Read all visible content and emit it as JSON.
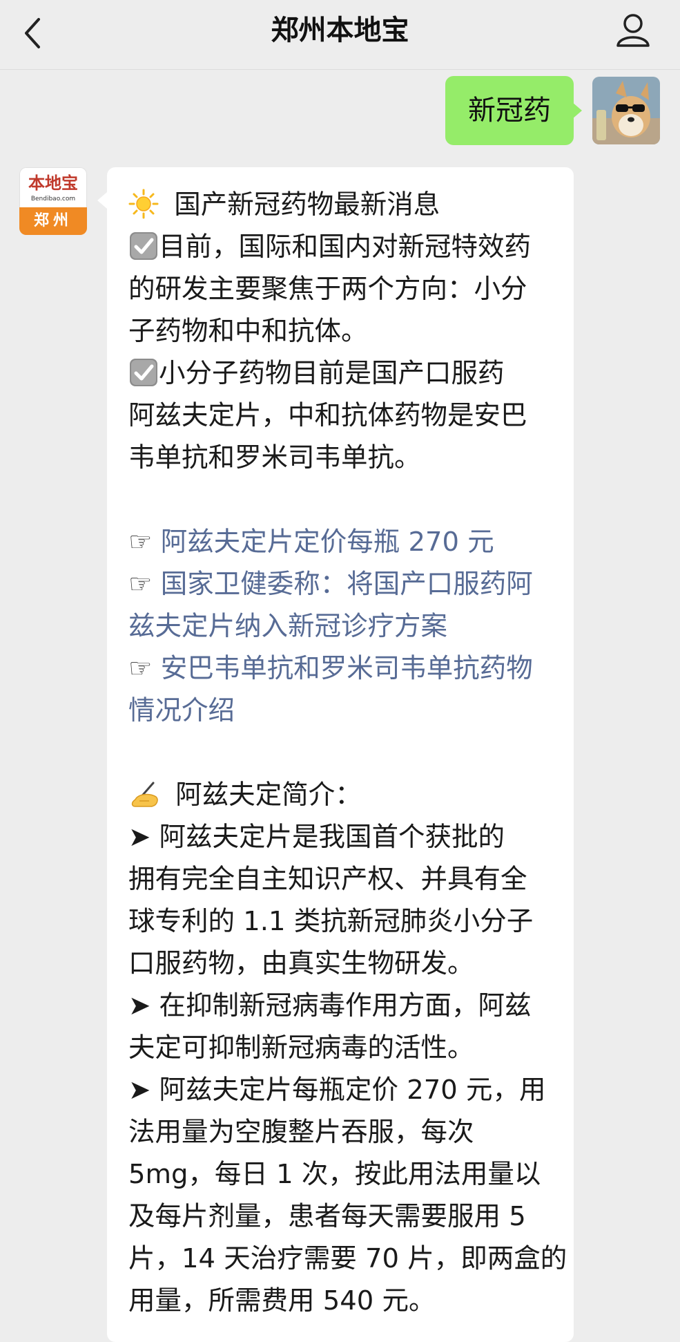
{
  "header": {
    "title": "郑州本地宝"
  },
  "sent": {
    "text": "新冠药"
  },
  "bot_avatar": {
    "logo_text": "本地宝",
    "logo_url": "Bendibao.com",
    "logo_city": "郑州"
  },
  "message": {
    "heading": "国产新冠药物最新消息",
    "p1": [
      "目前，国际和国内对新冠特效药",
      "的研发主要聚焦于两个方向：小分",
      "子药物和中和抗体。"
    ],
    "p2": [
      "小分子药物目前是国产口服药",
      "阿兹夫定片，中和抗体药物是安巴",
      "韦单抗和罗米司韦单抗。"
    ],
    "links": [
      [
        "阿兹夫定片定价每瓶 270 元"
      ],
      [
        "国家卫健委称：将国产口服药阿",
        "兹夫定片纳入新冠诊疗方案"
      ],
      [
        "安巴韦单抗和罗米司韦单抗药物",
        "情况介绍"
      ]
    ],
    "intro_title": "阿兹夫定简介：",
    "bullets": [
      [
        "阿兹夫定片是我国首个获批的",
        "拥有完全自主知识产权、并具有全",
        "球专利的 1.1 类抗新冠肺炎小分子",
        "口服药物，由真实生物研发。"
      ],
      [
        "在抑制新冠病毒作用方面，阿兹",
        "夫定可抑制新冠病毒的活性。"
      ],
      [
        "阿兹夫定片每瓶定价 270 元，用",
        "法用量为空腹整片吞服，每次",
        "5mg，每日 1 次，按此用法用量以",
        "及每片剂量，患者每天需要服用 5",
        "片，14 天治疗需要 70 片，即两盒的",
        "用量，所需费用 540 元。"
      ]
    ],
    "hand_symbol": "☞",
    "bullet_symbol": "➤"
  },
  "icons": [
    "back-icon",
    "profile-icon",
    "sun-icon",
    "check-icon",
    "writing-hand-icon"
  ],
  "colors": {
    "background": "#ededed",
    "sent_bubble": "#95ec69",
    "link": "#576b95",
    "logo_orange": "#f08a24",
    "logo_red": "#c0392b"
  }
}
